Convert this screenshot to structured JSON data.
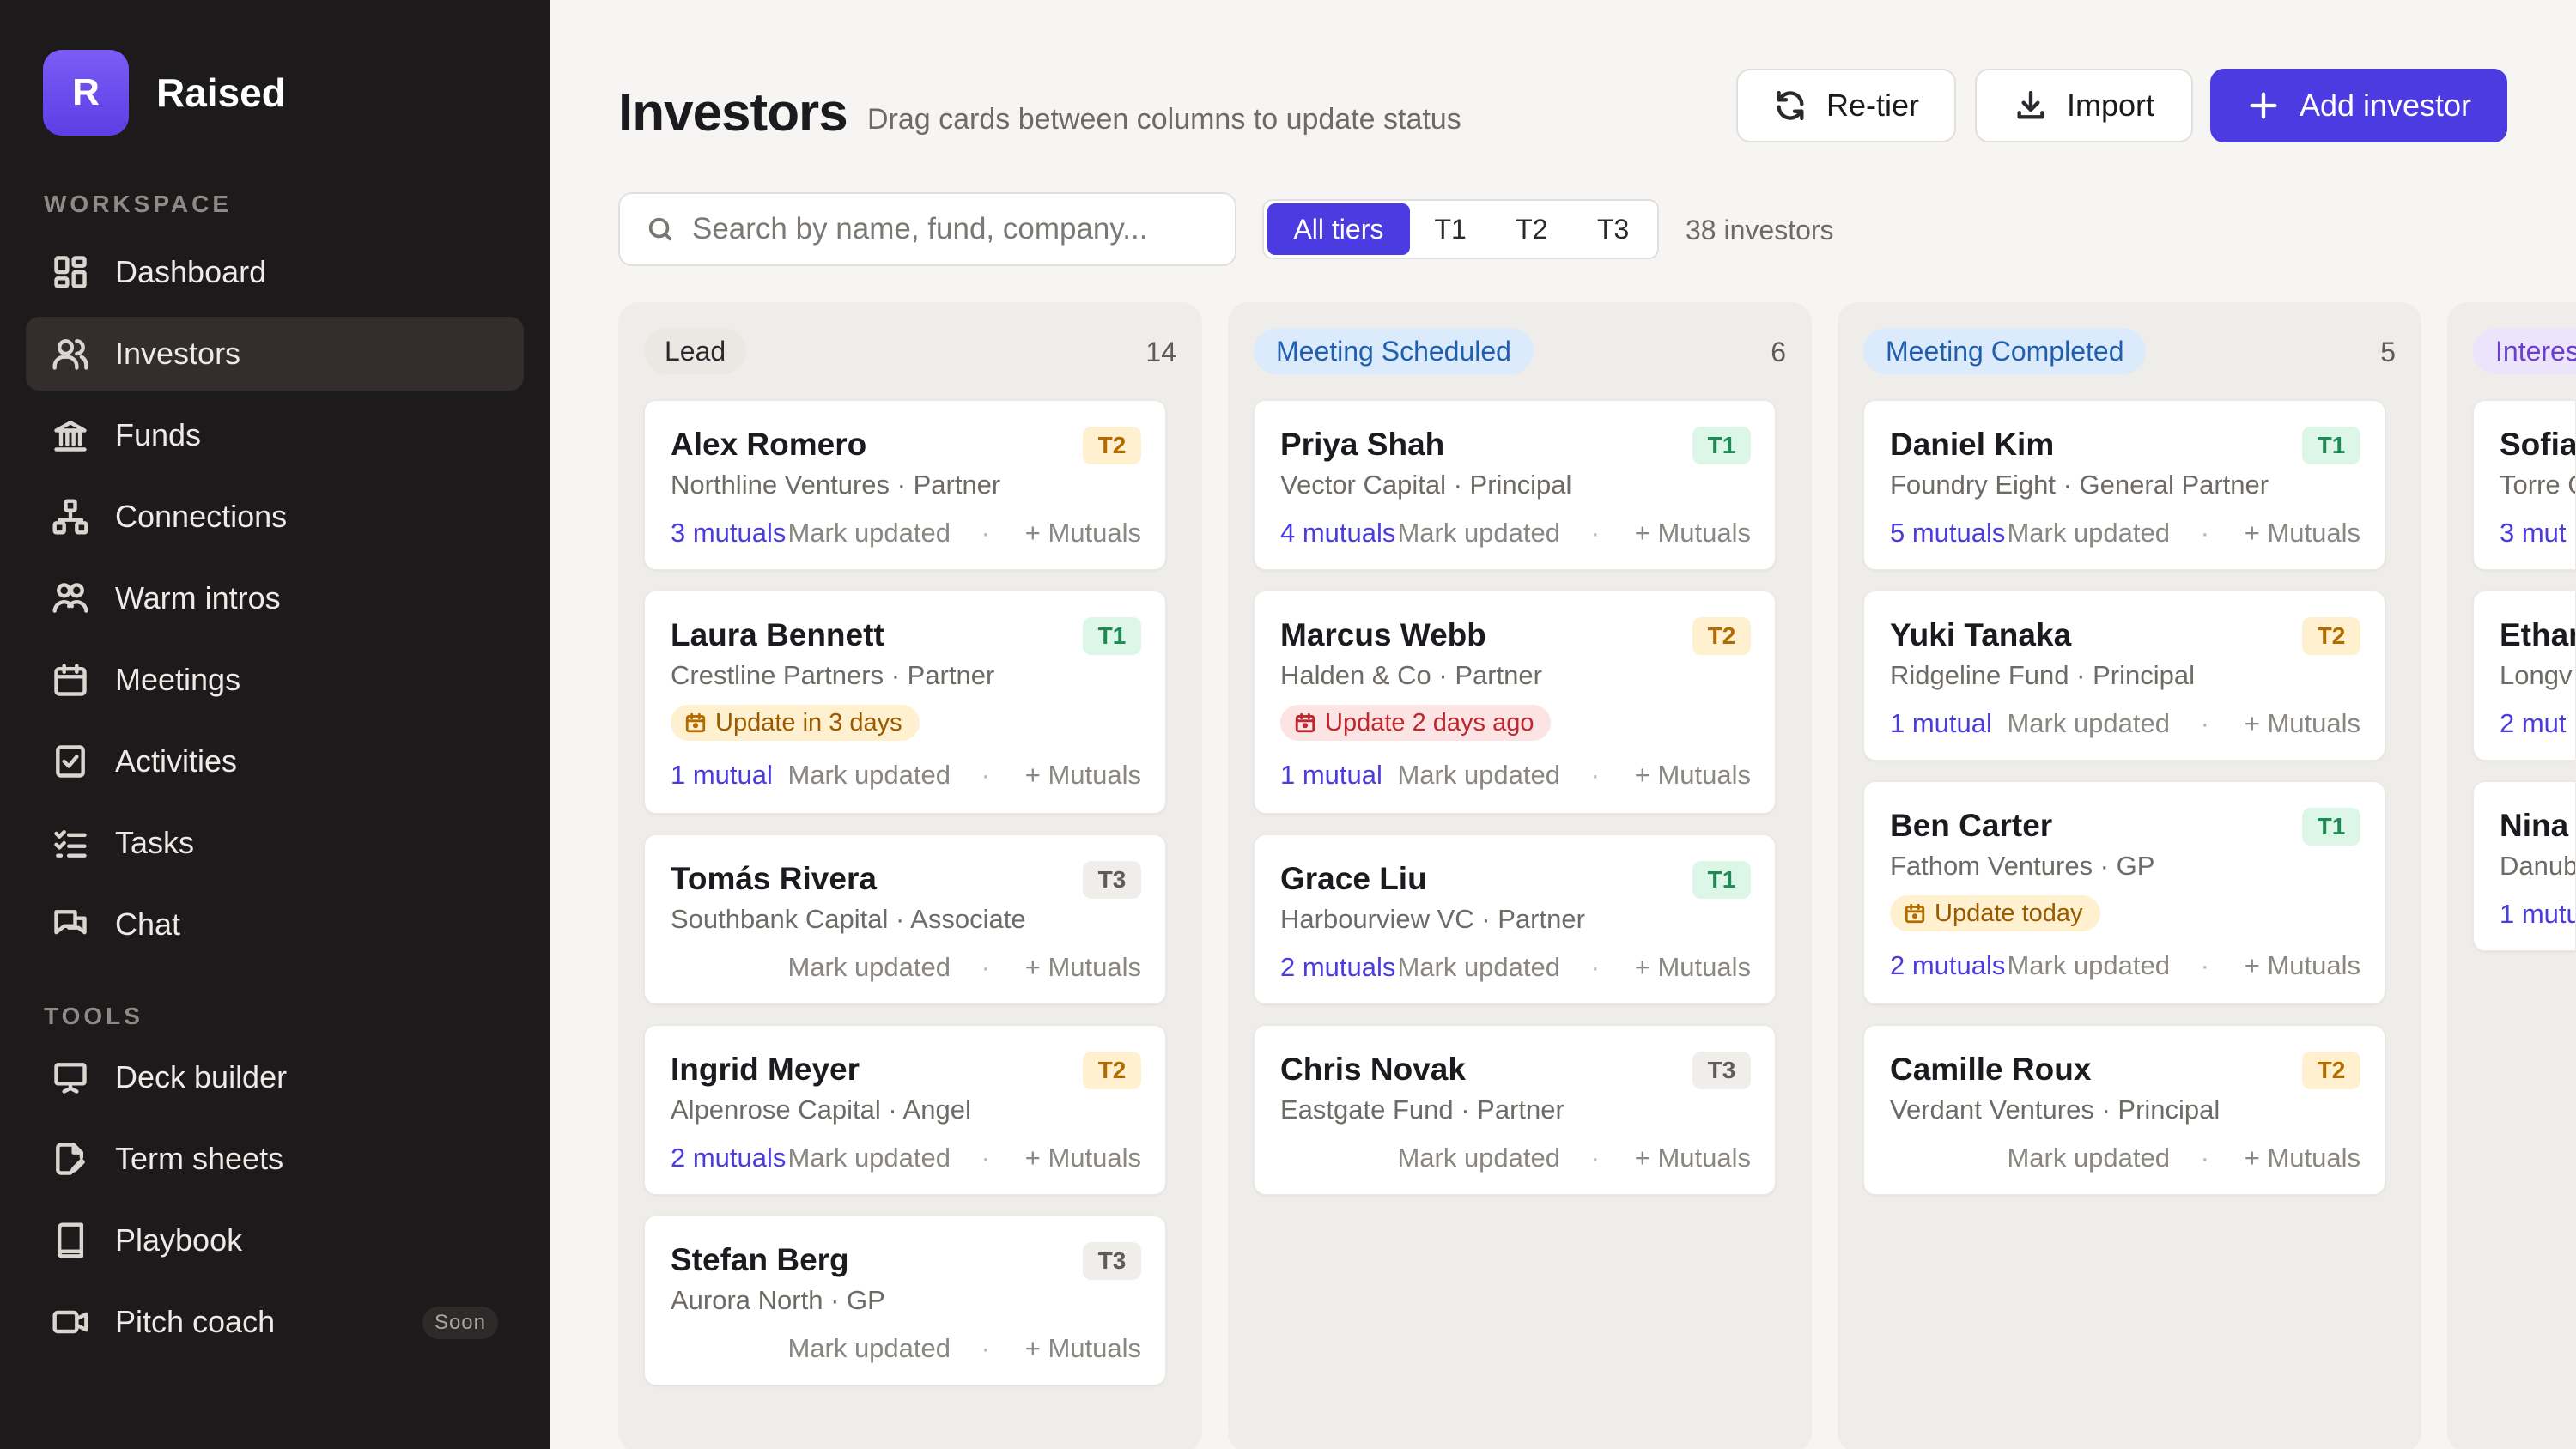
{
  "app": {
    "logo_letter": "R",
    "name": "Raised"
  },
  "sidebar": {
    "workspace_label": "WORKSPACE",
    "tools_label": "TOOLS",
    "workspace_items": [
      {
        "label": "Dashboard",
        "icon": "dashboard-icon"
      },
      {
        "label": "Investors",
        "icon": "users-icon",
        "active": true
      },
      {
        "label": "Funds",
        "icon": "bank-icon"
      },
      {
        "label": "Connections",
        "icon": "network-icon"
      },
      {
        "label": "Warm intros",
        "icon": "intro-icon"
      },
      {
        "label": "Meetings",
        "icon": "calendar-icon"
      },
      {
        "label": "Activities",
        "icon": "clipboard-check-icon"
      },
      {
        "label": "Tasks",
        "icon": "checklist-icon"
      },
      {
        "label": "Chat",
        "icon": "chat-icon"
      }
    ],
    "tools_items": [
      {
        "label": "Deck builder",
        "icon": "presentation-icon"
      },
      {
        "label": "Term sheets",
        "icon": "document-edit-icon"
      },
      {
        "label": "Playbook",
        "icon": "book-icon"
      },
      {
        "label": "Pitch coach",
        "icon": "video-icon",
        "badge": "Soon"
      }
    ]
  },
  "header": {
    "title": "Investors",
    "subtitle": "Drag cards between columns to update status",
    "retier_label": "Re-tier",
    "import_label": "Import",
    "add_label": "Add investor"
  },
  "toolbar": {
    "search_placeholder": "Search by name, fund, company...",
    "tiers": [
      "All tiers",
      "T1",
      "T2",
      "T3"
    ],
    "active_tier": "All tiers",
    "count_text": "38 investors"
  },
  "colors": {
    "accent": "#4b3be0",
    "t1": "#1f8a56",
    "t2": "#b36b00"
  },
  "columns": [
    {
      "title": "Lead",
      "count": "14",
      "cards": [
        {
          "name": "Alex Romero",
          "fund": "Northline Ventures · Partner",
          "tier": "T2",
          "mutuals": "3 mutuals",
          "mark": "Mark updated",
          "add": "+ Mutuals"
        },
        {
          "name": "Laura Bennett",
          "fund": "Crestline Partners · Partner",
          "tier": "T1",
          "reminder": "Update in 3 days",
          "mutuals": "1 mutual",
          "mark": "Mark updated",
          "add": "+ Mutuals"
        },
        {
          "name": "Tomás Rivera",
          "fund": "Southbank Capital · Associate",
          "tier": "T3",
          "mutuals": "",
          "mark": "Mark updated",
          "add": "+ Mutuals"
        },
        {
          "name": "Ingrid Meyer",
          "fund": "Alpenrose Capital · Angel",
          "tier": "T2",
          "mutuals": "2 mutuals",
          "mark": "Mark updated",
          "add": "+ Mutuals"
        },
        {
          "name": "Stefan Berg",
          "fund": "Aurora North · GP",
          "tier": "T3",
          "mutuals": "",
          "mark": "Mark updated",
          "add": "+ Mutuals"
        }
      ]
    },
    {
      "title": "Meeting Scheduled",
      "count": "6",
      "cards": [
        {
          "name": "Priya Shah",
          "fund": "Vector Capital · Principal",
          "tier": "T1",
          "mutuals": "4 mutuals",
          "mark": "Mark updated",
          "add": "+ Mutuals"
        },
        {
          "name": "Marcus Webb",
          "fund": "Halden & Co · Partner",
          "tier": "T2",
          "reminder": "Update 2 days ago",
          "mutuals": "1 mutual",
          "mark": "Mark updated",
          "add": "+ Mutuals"
        },
        {
          "name": "Grace Liu",
          "fund": "Harbourview VC · Partner",
          "tier": "T1",
          "mutuals": "2 mutuals",
          "mark": "Mark updated",
          "add": "+ Mutuals"
        },
        {
          "name": "Chris Novak",
          "fund": "Eastgate Fund · Partner",
          "tier": "T3",
          "mutuals": "",
          "mark": "Mark updated",
          "add": "+ Mutuals"
        }
      ]
    },
    {
      "title": "Meeting Completed",
      "count": "5",
      "cards": [
        {
          "name": "Daniel Kim",
          "fund": "Foundry Eight · General Partner",
          "tier": "T1",
          "mutuals": "5 mutuals",
          "mark": "Mark updated",
          "add": "+ Mutuals"
        },
        {
          "name": "Yuki Tanaka",
          "fund": "Ridgeline Fund · Principal",
          "tier": "T2",
          "mutuals": "1 mutual",
          "mark": "Mark updated",
          "add": "+ Mutuals"
        },
        {
          "name": "Ben Carter",
          "fund": "Fathom Ventures · GP",
          "tier": "T1",
          "reminder": "Update today",
          "mutuals": "2 mutuals",
          "mark": "Mark updated",
          "add": "+ Mutuals"
        },
        {
          "name": "Camille Roux",
          "fund": "Verdant Ventures · Principal",
          "tier": "T2",
          "mutuals": "",
          "mark": "Mark updated",
          "add": "+ Mutuals"
        }
      ]
    },
    {
      "title": "Interes",
      "cards": [
        {
          "name": "Sofia",
          "fund": "Torre C",
          "mutuals": "3 mut"
        },
        {
          "name": "Ethan",
          "fund": "Longv",
          "mutuals": "2 mut"
        },
        {
          "name": "Nina",
          "fund": "Danub",
          "mutuals": "1 mutu"
        }
      ]
    }
  ]
}
